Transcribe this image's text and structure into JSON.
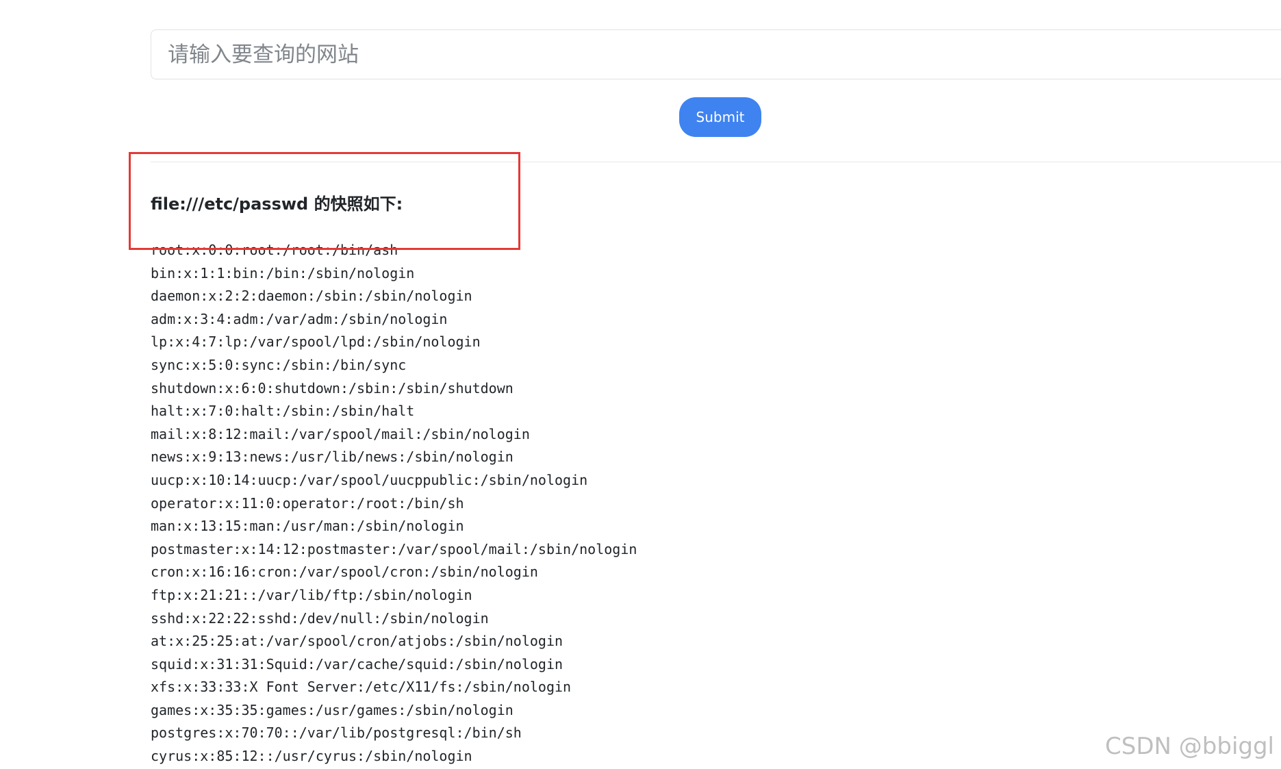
{
  "search": {
    "placeholder": "请输入要查询的网站",
    "value": ""
  },
  "submit_label": "Submit",
  "result": {
    "heading": "file:///etc/passwd 的快照如下:",
    "lines": [
      "root:x:0:0:root:/root:/bin/ash",
      "bin:x:1:1:bin:/bin:/sbin/nologin",
      "daemon:x:2:2:daemon:/sbin:/sbin/nologin",
      "adm:x:3:4:adm:/var/adm:/sbin/nologin",
      "lp:x:4:7:lp:/var/spool/lpd:/sbin/nologin",
      "sync:x:5:0:sync:/sbin:/bin/sync",
      "shutdown:x:6:0:shutdown:/sbin:/sbin/shutdown",
      "halt:x:7:0:halt:/sbin:/sbin/halt",
      "mail:x:8:12:mail:/var/spool/mail:/sbin/nologin",
      "news:x:9:13:news:/usr/lib/news:/sbin/nologin",
      "uucp:x:10:14:uucp:/var/spool/uucppublic:/sbin/nologin",
      "operator:x:11:0:operator:/root:/bin/sh",
      "man:x:13:15:man:/usr/man:/sbin/nologin",
      "postmaster:x:14:12:postmaster:/var/spool/mail:/sbin/nologin",
      "cron:x:16:16:cron:/var/spool/cron:/sbin/nologin",
      "ftp:x:21:21::/var/lib/ftp:/sbin/nologin",
      "sshd:x:22:22:sshd:/dev/null:/sbin/nologin",
      "at:x:25:25:at:/var/spool/cron/atjobs:/sbin/nologin",
      "squid:x:31:31:Squid:/var/cache/squid:/sbin/nologin",
      "xfs:x:33:33:X Font Server:/etc/X11/fs:/sbin/nologin",
      "games:x:35:35:games:/usr/games:/sbin/nologin",
      "postgres:x:70:70::/var/lib/postgresql:/bin/sh",
      "cyrus:x:85:12::/usr/cyrus:/sbin/nologin"
    ]
  },
  "watermark": "CSDN @bbiggl",
  "colors": {
    "submit_button": "#3f83f0",
    "highlight_box": "#e53935",
    "divider": "#e6e8eb"
  }
}
